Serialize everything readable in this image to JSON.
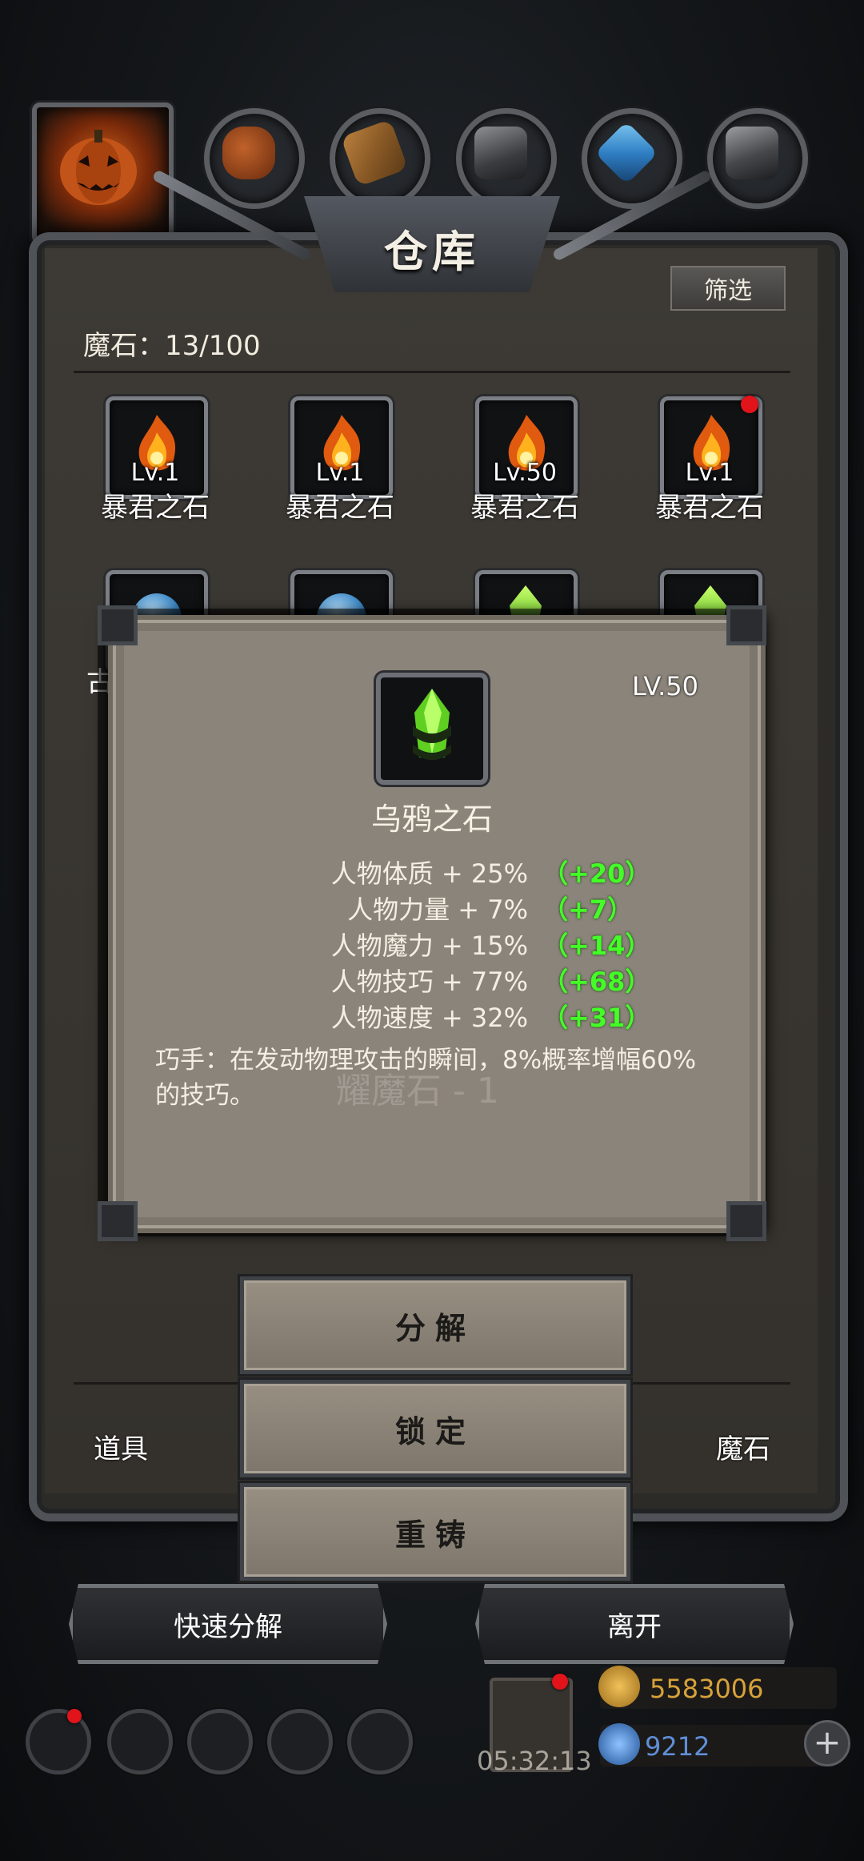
{
  "top_bar": {
    "resources": [
      {
        "icon": "pumpkin-avatar-icon"
      },
      {
        "icon": "leather-icon"
      },
      {
        "icon": "wood-icon"
      },
      {
        "icon": "iron-ore-icon"
      },
      {
        "icon": "blue-crystal-icon"
      },
      {
        "icon": "metal-ingot-icon"
      }
    ]
  },
  "warehouse": {
    "title": "仓库",
    "filter_label": "筛选",
    "stone_count": "魔石：13/100",
    "items": [
      {
        "level": "Lv.1",
        "name": "暴君之石",
        "icon": "flame-stone-icon",
        "new": false
      },
      {
        "level": "Lv.1",
        "name": "暴君之石",
        "icon": "flame-stone-icon",
        "new": false
      },
      {
        "level": "Lv.50",
        "name": "暴君之石",
        "icon": "flame-stone-icon",
        "new": false
      },
      {
        "level": "Lv.1",
        "name": "暴君之石",
        "icon": "flame-stone-icon",
        "new": true
      }
    ],
    "partial_label_left": "古"
  },
  "popup": {
    "level": "LV.50",
    "name": "乌鸦之石",
    "icon": "crow-stone-icon",
    "stats": [
      {
        "label": "人物体质 + 25%",
        "bonus": "（+20）"
      },
      {
        "label": "人物力量 + 7%",
        "bonus": "（+7）"
      },
      {
        "label": "人物魔力 + 15%",
        "bonus": "（+14）"
      },
      {
        "label": "人物技巧 + 77%",
        "bonus": "（+68）"
      },
      {
        "label": "人物速度 + 32%",
        "bonus": "（+31）"
      }
    ],
    "description_line1": "巧手：在发动物理攻击的瞬间，8%概率增幅60%",
    "description_line2": "的技巧。",
    "ghost_text": "耀魔石 - 1"
  },
  "actions": {
    "decompose": "分解",
    "lock": "锁定",
    "reforge": "重铸"
  },
  "tabs": {
    "items": "道具",
    "stones": "魔石"
  },
  "bottom": {
    "quick_decompose": "快速分解",
    "leave": "离开"
  },
  "hud": {
    "timer": "05:32:13",
    "gold": "5583006",
    "crystal": "9212",
    "plus": "+"
  },
  "colors": {
    "stat_bonus": "#43ff27",
    "badge": "#e0141a",
    "gold": "#d7a23a",
    "crystal": "#5f8fd6"
  }
}
